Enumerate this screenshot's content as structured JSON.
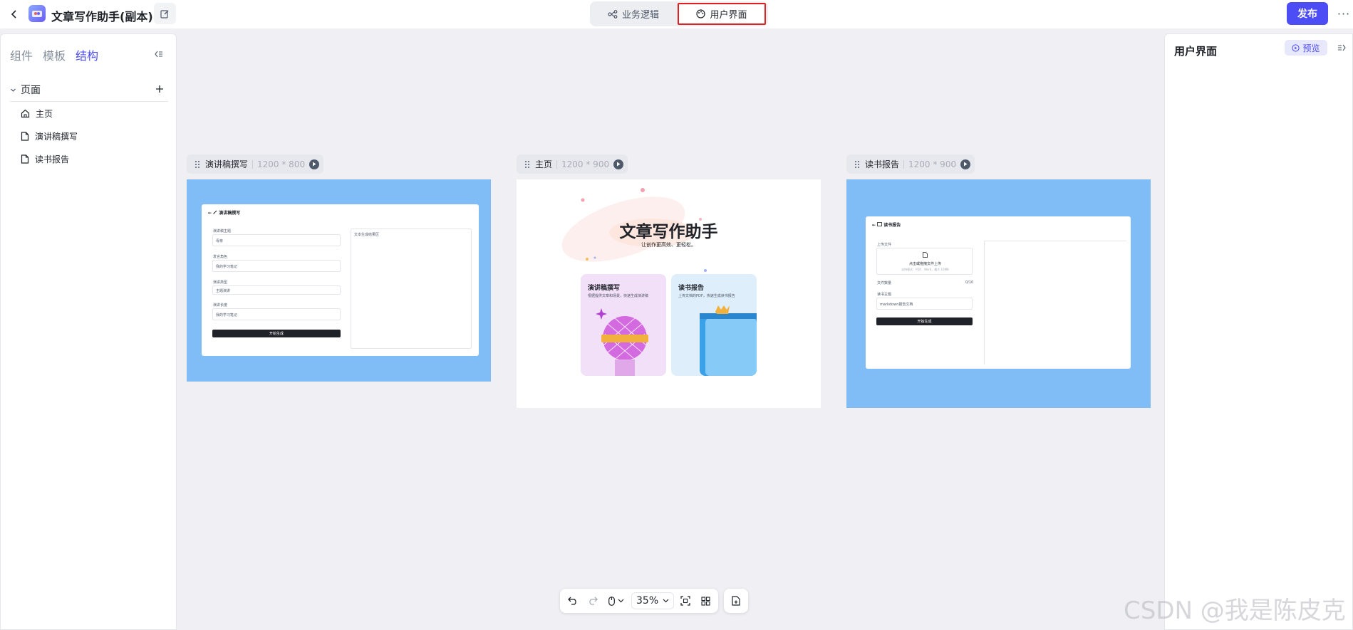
{
  "app": {
    "title": "文章写作助手(副本)"
  },
  "header": {
    "tabs": [
      {
        "label": "业务逻辑"
      },
      {
        "label": "用户界面"
      }
    ],
    "publish_label": "发布",
    "more_label": "···"
  },
  "left_panel": {
    "tabs": [
      {
        "label": "组件"
      },
      {
        "label": "模板"
      },
      {
        "label": "结构"
      }
    ],
    "section_label": "页面",
    "pages": [
      {
        "label": "主页"
      },
      {
        "label": "演讲稿撰写"
      },
      {
        "label": "读书报告"
      }
    ]
  },
  "right_panel": {
    "title": "用户界面",
    "preview_label": "预览"
  },
  "canvas": {
    "frames": [
      {
        "name": "演讲稿撰写",
        "size": "1200 * 800"
      },
      {
        "name": "主页",
        "size": "1200 * 900"
      },
      {
        "name": "读书报告",
        "size": "1200 * 900"
      }
    ],
    "speech": {
      "head": "演讲稿撰写",
      "fields": [
        {
          "label": "演讲稿主题",
          "value": "母亲"
        },
        {
          "label": "发言角色",
          "value": "我的学习笔记"
        },
        {
          "label": "演讲类型",
          "value": "主题演讲"
        },
        {
          "label": "演讲长度",
          "value": "我的学习笔记"
        }
      ],
      "button": "开始生成",
      "output": "文本生成结果区"
    },
    "home": {
      "title": "文章写作助手",
      "subtitle": "让创作更高效、更轻松。",
      "cards": [
        {
          "title": "演讲稿撰写",
          "desc": "根据提供文章和场景，快速生成演讲稿"
        },
        {
          "title": "读书报告",
          "desc": "上传文档的PDF，快速生成读书报告"
        }
      ]
    },
    "report": {
      "head": "读书报告",
      "upload_label": "上传文件",
      "upload_hint": "点击或拖拽文件上传",
      "upload_sub": "支持格式：PDF、Word，最大 10MB",
      "count_label": "文件数量",
      "count_value": "0/10",
      "topic_label": "读书主题",
      "topic_value": "markdown报告文档",
      "button": "开始生成"
    },
    "zoom": "35%"
  },
  "watermark": "CSDN @我是陈皮克",
  "colors": {
    "accent": "#4d4df5",
    "frame_blue": "#80bdf7",
    "highlight_border": "#e02020"
  }
}
